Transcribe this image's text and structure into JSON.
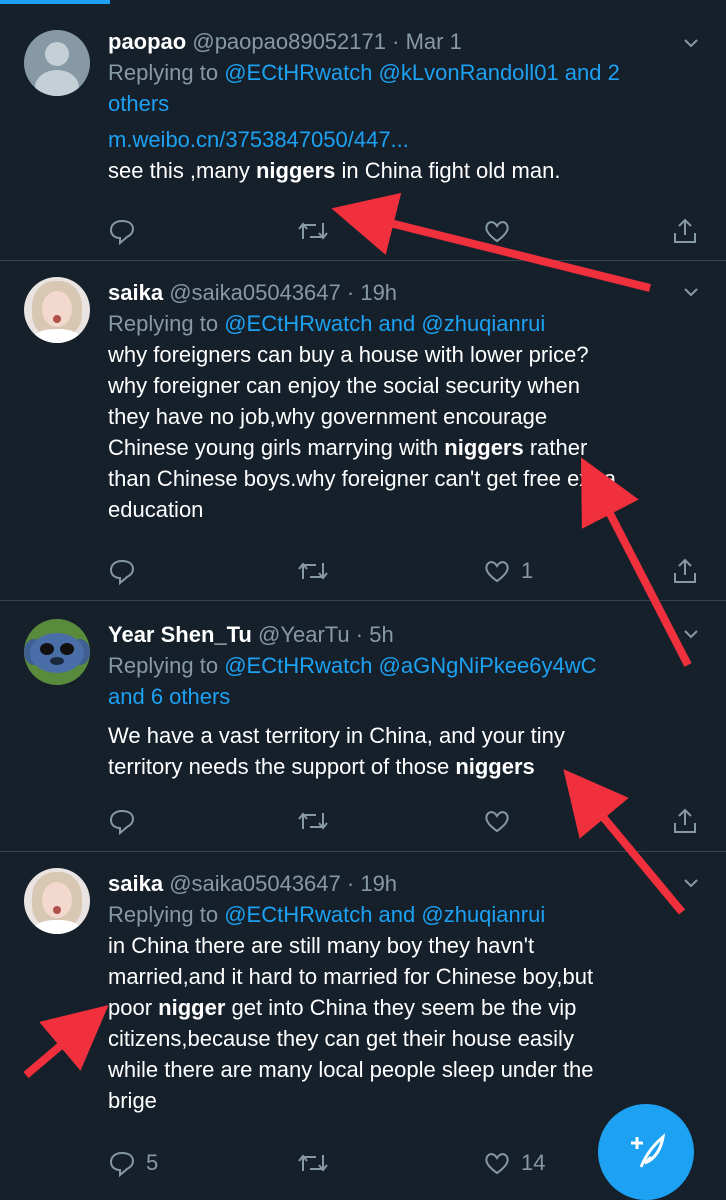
{
  "tweets": [
    {
      "name": "paopao",
      "handle": "@paopao89052171",
      "time": "· Mar 1",
      "replying_prefix": "Replying to ",
      "replying_line1": "@ECtHRwatch @kLvonRandoll01 and 2",
      "replying_line2": "others",
      "link": "m.weibo.cn/3753847050/447...",
      "text_lines": [
        {
          "before": "see this ,many ",
          "bold": "niggers",
          "after": " in China fight old man."
        }
      ],
      "reply_count": "",
      "retweet_count": "",
      "like_count": ""
    },
    {
      "name": "saika",
      "handle": "@saika05043647",
      "time": "· 19h",
      "replying_prefix": "Replying to ",
      "replying_line1": "@ECtHRwatch and @zhuqianrui",
      "text_lines": [
        {
          "before": "why foreigners can buy a house with lower price?",
          "bold": "",
          "after": ""
        },
        {
          "before": "why foreigner can enjoy the social security when",
          "bold": "",
          "after": ""
        },
        {
          "before": "they have no job,why government encourage",
          "bold": "",
          "after": ""
        },
        {
          "before": "Chinese young girls marrying with ",
          "bold": "niggers",
          "after": " rather"
        },
        {
          "before": "than Chinese boys.why foreigner can't get free extra",
          "bold": "",
          "after": ""
        },
        {
          "before": "education",
          "bold": "",
          "after": ""
        }
      ],
      "reply_count": "",
      "retweet_count": "",
      "like_count": "1"
    },
    {
      "name": "Year Shen_Tu",
      "handle": "@YearTu",
      "time": "· 5h",
      "replying_prefix": "Replying to ",
      "replying_line1": "@ECtHRwatch @aGNgNiPkee6y4wC",
      "replying_line2": "and 6 others",
      "text_lines": [
        {
          "before": "We have a vast territory in China, and your tiny",
          "bold": "",
          "after": ""
        },
        {
          "before": "territory needs the support of those ",
          "bold": "niggers",
          "after": ""
        }
      ],
      "reply_count": "",
      "retweet_count": "",
      "like_count": ""
    },
    {
      "name": "saika",
      "handle": "@saika05043647",
      "time": "· 19h",
      "replying_prefix": "Replying to ",
      "replying_line1": "@ECtHRwatch and @zhuqianrui",
      "text_lines": [
        {
          "before": "in China there are still many boy they havn't",
          "bold": "",
          "after": ""
        },
        {
          "before": "married,and it hard to married for Chinese boy,but",
          "bold": "",
          "after": ""
        },
        {
          "before": "poor ",
          "bold": "nigger",
          "after": " get into China they seem be the vip"
        },
        {
          "before": "citizens,because they can get their house easily",
          "bold": "",
          "after": ""
        },
        {
          "before": "while there are many local people sleep under the",
          "bold": "",
          "after": ""
        },
        {
          "before": "brige",
          "bold": "",
          "after": ""
        }
      ],
      "reply_count": "5",
      "retweet_count": "",
      "like_count": "14"
    }
  ],
  "colors": {
    "background": "#15202b",
    "accent": "#1da1f2",
    "muted": "#8899a6",
    "annotation_arrow": "#f0303c"
  },
  "icons": [
    "chevron-down-icon",
    "reply-icon",
    "retweet-icon",
    "like-icon",
    "share-icon",
    "compose-icon",
    "red-arrow-annotation"
  ]
}
